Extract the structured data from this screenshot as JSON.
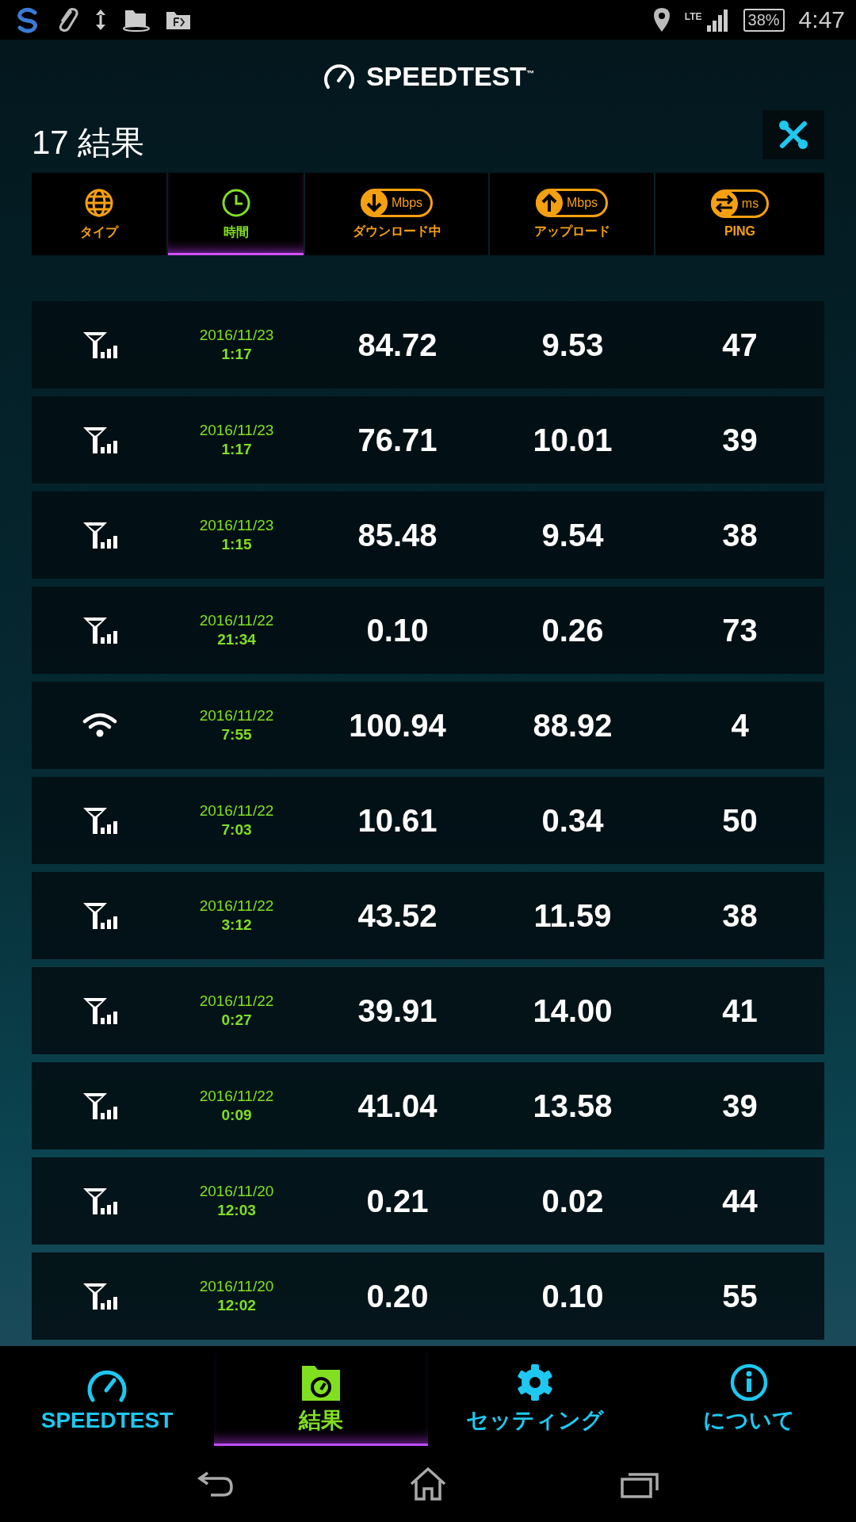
{
  "status_bar": {
    "network": "LTE",
    "battery": "38%",
    "time": "4:47"
  },
  "app_title": "SPEEDTEST",
  "trademark": "™",
  "results_title": "17 結果",
  "columns": [
    {
      "kind": "type",
      "label": "タイプ",
      "selected": false
    },
    {
      "kind": "time",
      "label": "時間",
      "selected": true
    },
    {
      "kind": "download",
      "label": "ダウンロード中",
      "unit": "Mbps",
      "selected": false
    },
    {
      "kind": "upload",
      "label": "アップロード",
      "unit": "Mbps",
      "selected": false
    },
    {
      "kind": "ping",
      "label": "PING",
      "unit": "ms",
      "selected": false
    }
  ],
  "rows": [
    {
      "kind": "cellular",
      "date": "2016/11/23",
      "time": "1:17",
      "download": "84.72",
      "upload": "9.53",
      "ping": "47"
    },
    {
      "kind": "cellular",
      "date": "2016/11/23",
      "time": "1:17",
      "download": "76.71",
      "upload": "10.01",
      "ping": "39"
    },
    {
      "kind": "cellular",
      "date": "2016/11/23",
      "time": "1:15",
      "download": "85.48",
      "upload": "9.54",
      "ping": "38"
    },
    {
      "kind": "cellular",
      "date": "2016/11/22",
      "time": "21:34",
      "download": "0.10",
      "upload": "0.26",
      "ping": "73"
    },
    {
      "kind": "wifi",
      "date": "2016/11/22",
      "time": "7:55",
      "download": "100.94",
      "upload": "88.92",
      "ping": "4"
    },
    {
      "kind": "cellular",
      "date": "2016/11/22",
      "time": "7:03",
      "download": "10.61",
      "upload": "0.34",
      "ping": "50"
    },
    {
      "kind": "cellular",
      "date": "2016/11/22",
      "time": "3:12",
      "download": "43.52",
      "upload": "11.59",
      "ping": "38"
    },
    {
      "kind": "cellular",
      "date": "2016/11/22",
      "time": "0:27",
      "download": "39.91",
      "upload": "14.00",
      "ping": "41"
    },
    {
      "kind": "cellular",
      "date": "2016/11/22",
      "time": "0:09",
      "download": "41.04",
      "upload": "13.58",
      "ping": "39"
    },
    {
      "kind": "cellular",
      "date": "2016/11/20",
      "time": "12:03",
      "download": "0.21",
      "upload": "0.02",
      "ping": "44"
    },
    {
      "kind": "cellular",
      "date": "2016/11/20",
      "time": "12:02",
      "download": "0.20",
      "upload": "0.10",
      "ping": "55"
    }
  ],
  "bottom_nav": [
    {
      "kind": "speedtest",
      "label": "SPEEDTEST",
      "selected": false
    },
    {
      "kind": "results",
      "label": "結果",
      "selected": true
    },
    {
      "kind": "settings",
      "label": "セッティング",
      "selected": false
    },
    {
      "kind": "about",
      "label": "について",
      "selected": false
    }
  ]
}
